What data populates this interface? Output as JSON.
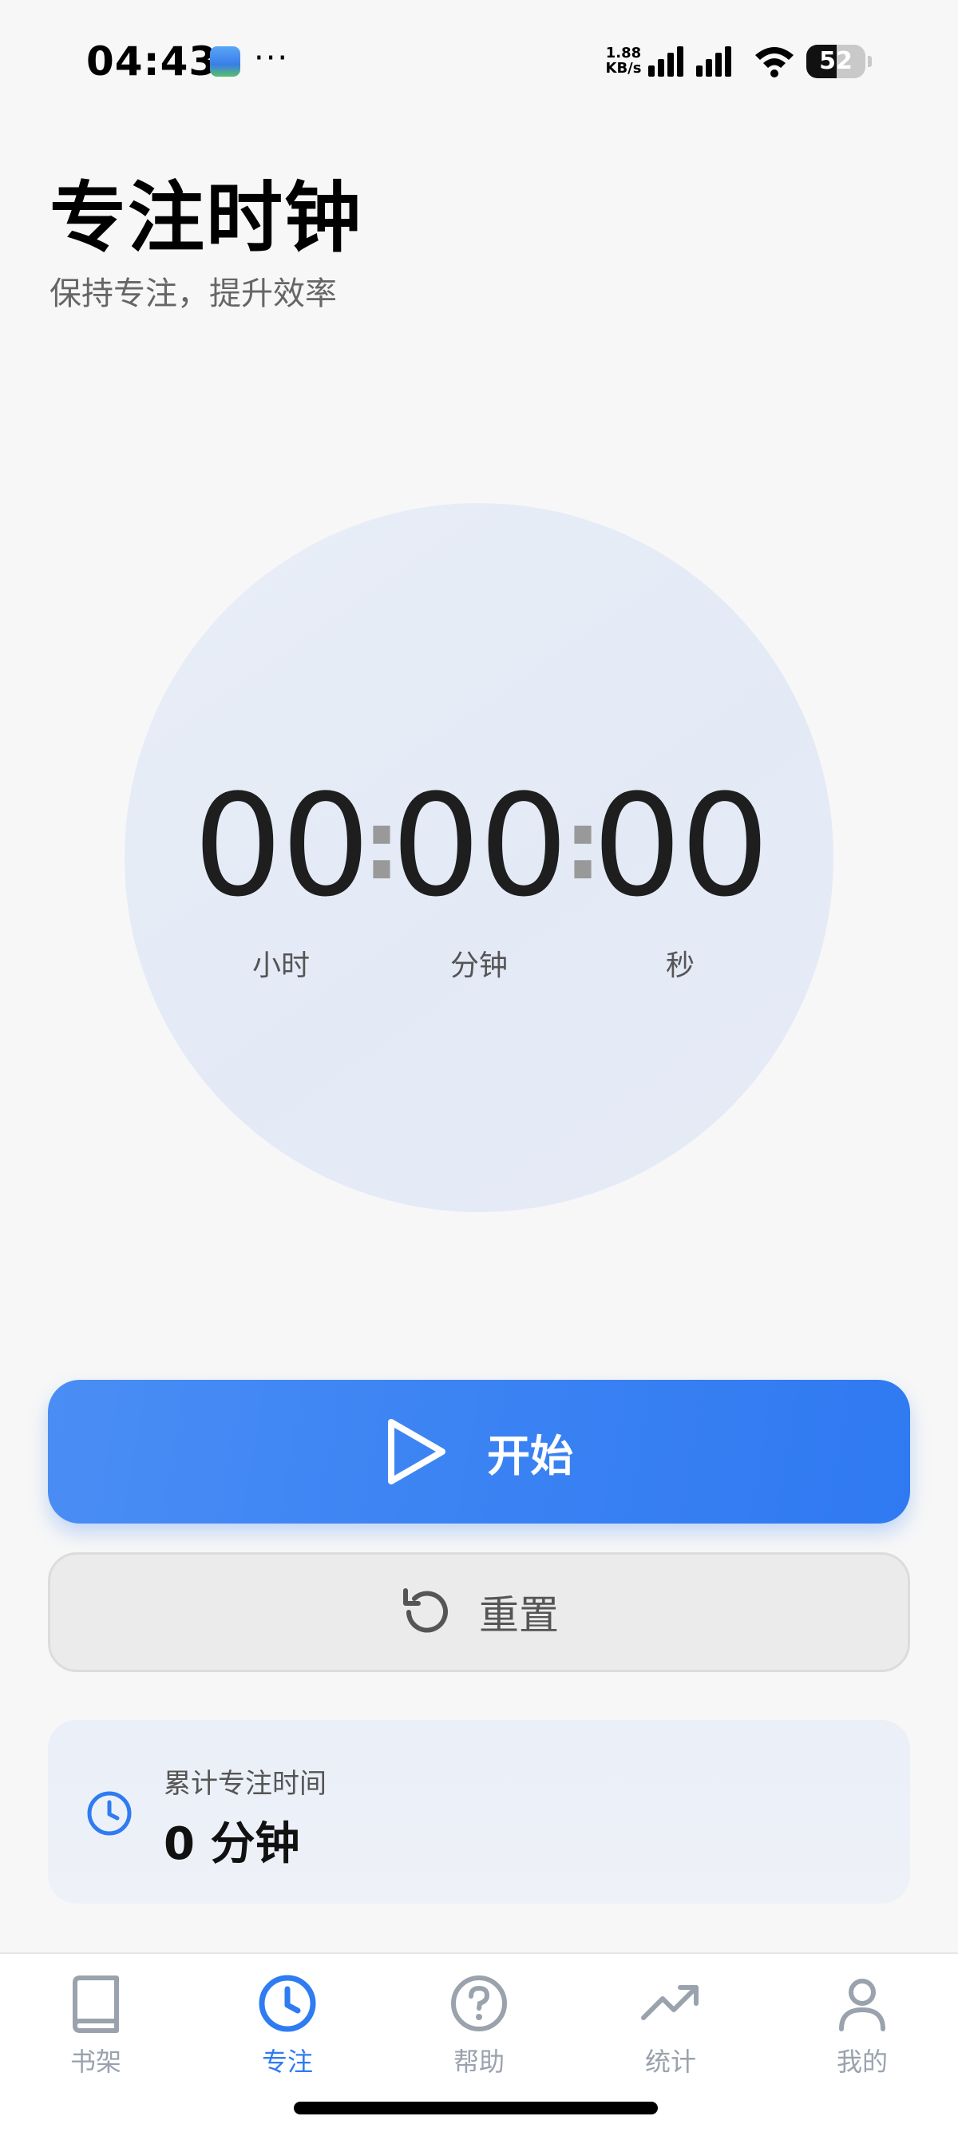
{
  "status_bar": {
    "time": "04:43",
    "more": "···",
    "net_speed_value": "1.88",
    "net_speed_unit": "KB/s",
    "battery_level": "52",
    "battery_fraction": 0.52
  },
  "header": {
    "title": "专注时钟",
    "subtitle": "保持专注，提升效率"
  },
  "timer": {
    "hours": "00",
    "minutes": "00",
    "seconds": "00",
    "separator": ":",
    "hours_label": "小时",
    "minutes_label": "分钟",
    "seconds_label": "秒"
  },
  "actions": {
    "start_label": "开始",
    "reset_label": "重置"
  },
  "stats": {
    "label": "累计专注时间",
    "value": "0 分钟"
  },
  "nav": {
    "items": [
      {
        "label": "书架",
        "icon": "book-icon",
        "active": false
      },
      {
        "label": "专注",
        "icon": "clock-icon",
        "active": true
      },
      {
        "label": "帮助",
        "icon": "help-icon",
        "active": false
      },
      {
        "label": "统计",
        "icon": "trending-up-icon",
        "active": false
      },
      {
        "label": "我的",
        "icon": "user-icon",
        "active": false
      }
    ]
  },
  "colors": {
    "accent": "#2f7bf2",
    "inactive_nav": "#9aa2ad",
    "background": "#f7f7f7"
  }
}
